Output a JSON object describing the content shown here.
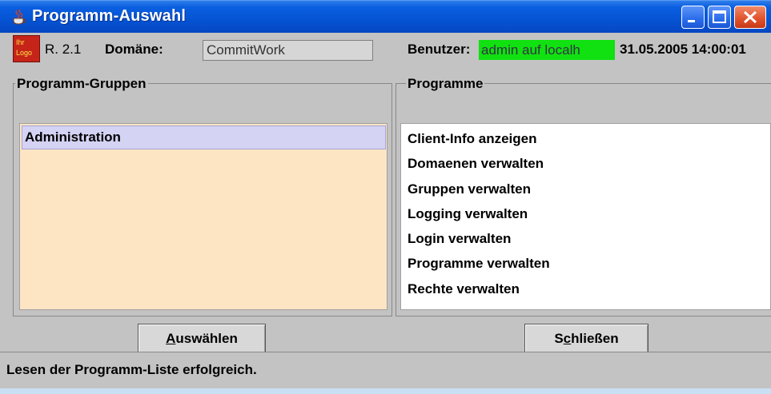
{
  "window": {
    "title": "Programm-Auswahl",
    "controls": {
      "minimize_icon": "minimize-icon",
      "maximize_icon": "maximize-icon",
      "close_icon": "close-icon"
    }
  },
  "info": {
    "logo_text_line1": "Ihr",
    "logo_text_line2": "Logo",
    "release": "R. 2.1",
    "domain_label": "Domäne:",
    "domain_value": "CommitWork",
    "user_label": "Benutzer:",
    "user_value": "admin auf localh",
    "datetime": "31.05.2005 14:00:01"
  },
  "groups_panel": {
    "title": "Programm-Gruppen",
    "items": [
      {
        "label": "Administration",
        "selected": true
      }
    ]
  },
  "programs_panel": {
    "title": "Programme",
    "items": [
      "Client-Info anzeigen",
      "Domaenen verwalten",
      "Gruppen verwalten",
      "Logging verwalten",
      "Login verwalten",
      "Programme verwalten",
      "Rechte verwalten"
    ]
  },
  "buttons": {
    "select": {
      "mnemonic": "A",
      "rest": "uswählen"
    },
    "close": {
      "pre": "S",
      "mnemonic": "c",
      "rest": "hließen"
    }
  },
  "status": {
    "message": "Lesen der Programm-Liste erfolgreich."
  },
  "colors": {
    "titlebar": "#0553d3",
    "user_highlight": "#11e011",
    "groups_list_bg": "#fde5c4",
    "selection": "#d5d3f4"
  }
}
